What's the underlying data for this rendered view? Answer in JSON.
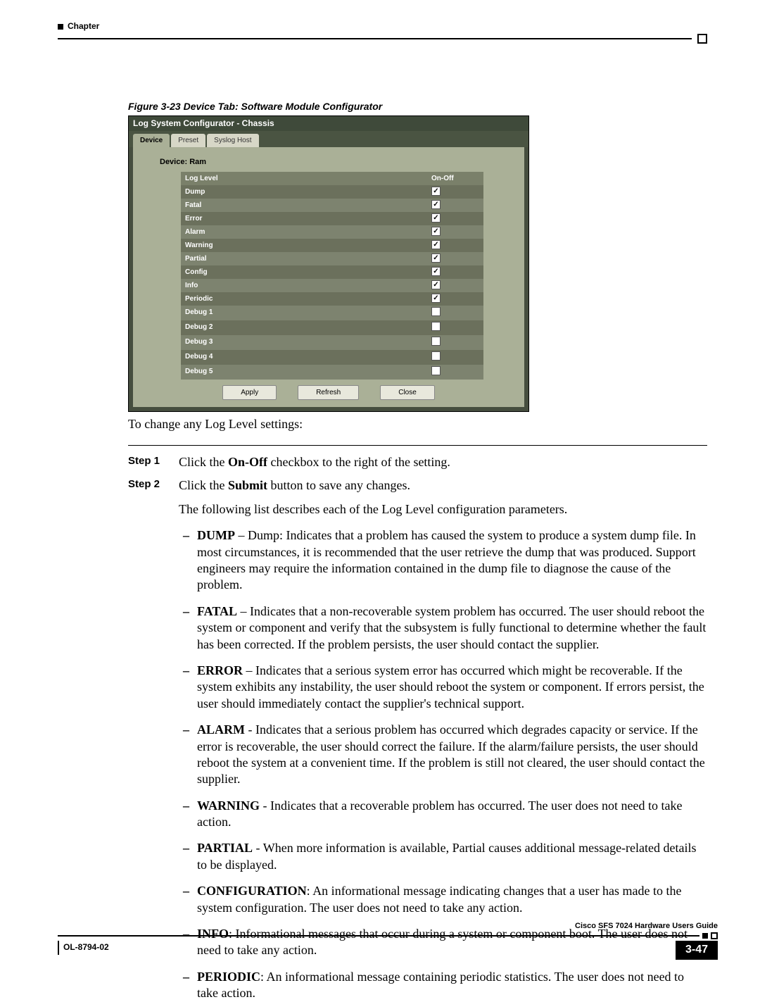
{
  "header": {
    "chapter": "Chapter"
  },
  "figure": {
    "caption": "Figure 3-23   Device Tab: Software Module Configurator",
    "window_title": "Log System Configurator - Chassis",
    "tabs": [
      "Device",
      "Preset",
      "Syslog Host"
    ],
    "device_label": "Device: Ram",
    "grid_headers": {
      "c1": "Log Level",
      "c2": "On-Off"
    },
    "rows": [
      {
        "label": "Dump",
        "checked": true
      },
      {
        "label": "Fatal",
        "checked": true
      },
      {
        "label": "Error",
        "checked": true
      },
      {
        "label": "Alarm",
        "checked": true
      },
      {
        "label": "Warning",
        "checked": true
      },
      {
        "label": "Partial",
        "checked": true
      },
      {
        "label": "Config",
        "checked": true
      },
      {
        "label": "Info",
        "checked": true
      },
      {
        "label": "Periodic",
        "checked": true
      },
      {
        "label": "Debug 1",
        "checked": false
      },
      {
        "label": "Debug 2",
        "checked": false
      },
      {
        "label": "Debug 3",
        "checked": false
      },
      {
        "label": "Debug 4",
        "checked": false
      },
      {
        "label": "Debug 5",
        "checked": false
      }
    ],
    "buttons": {
      "apply": "Apply",
      "refresh": "Refresh",
      "close": "Close"
    }
  },
  "intro": "To change any Log Level settings:",
  "steps": {
    "label1": "Step 1",
    "text1_a": "Click the ",
    "text1_b": "On-Off",
    "text1_c": " checkbox to the right of the setting.",
    "label2": "Step 2",
    "text2_a": "Click the ",
    "text2_b": "Submit",
    "text2_c": " button to save any changes."
  },
  "list_intro": "The following list describes each of the Log Level configuration parameters.",
  "bullets": [
    {
      "term": "DUMP",
      "sep": " – ",
      "text": "Dump: Indicates that a problem has caused the system to produce a system dump file. In most circumstances, it is recommended that the user retrieve the dump that was produced. Support engineers may require the information contained in the dump file to diagnose the cause of the problem."
    },
    {
      "term": "FATAL",
      "sep": " – ",
      "text": "Indicates that a non-recoverable system problem has occurred. The user should reboot the system or component and verify that the subsystem is fully functional to determine whether the fault has been corrected. If the problem persists, the user should contact the supplier."
    },
    {
      "term": "ERROR",
      "sep": " – ",
      "text": "Indicates that a serious system error has occurred which might be recoverable. If the system exhibits any instability, the user should reboot the system or component. If errors persist, the user should immediately contact the supplier's technical support."
    },
    {
      "term": "ALARM",
      "sep": " - ",
      "text": "Indicates that a serious problem has occurred which degrades capacity or service. If the error is recoverable, the user should correct the failure. If the alarm/failure persists, the user should reboot the system at a convenient time. If the problem is still not cleared, the user should contact the supplier."
    },
    {
      "term": "WARNING",
      "sep": " - ",
      "text": "Indicates that a recoverable problem has occurred. The user does not need to take action."
    },
    {
      "term": "PARTIAL",
      "sep": " - ",
      "text": "When more information is available, Partial causes additional message-related details to be displayed."
    },
    {
      "term": "CONFIGURATION",
      "sep": ": ",
      "text": "An informational message indicating changes that a user has made to the system configuration. The user does not need to take any action."
    },
    {
      "term": "INFO",
      "sep": ": ",
      "text": "Informational messages that occur during a system or component boot. The user does not need to take any action."
    },
    {
      "term": "PERIODIC",
      "sep": ": ",
      "text": "An informational message containing periodic statistics. The user does not need to take action."
    }
  ],
  "footer": {
    "guide": "Cisco SFS 7024 Hardware Users Guide",
    "ol": "OL-8794-02",
    "page": "3-47"
  }
}
